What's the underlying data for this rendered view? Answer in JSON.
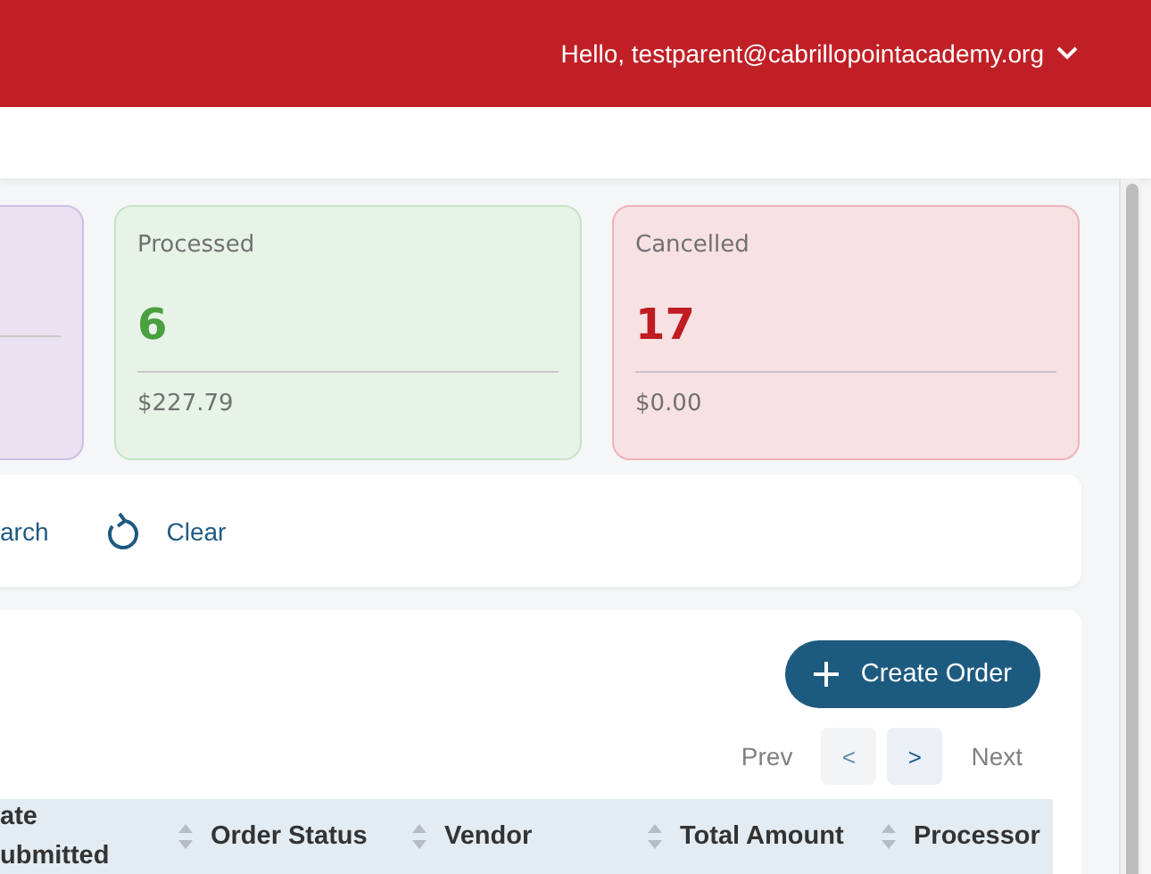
{
  "header": {
    "greeting": "Hello, testparent@cabrillopointacademy.org"
  },
  "summary_cards": [
    {
      "color": "#e9e3f1"
    },
    {
      "label": "Processed",
      "count": "6",
      "amount": "$227.79",
      "color": "#e8f3e8"
    },
    {
      "label": "Cancelled",
      "count": "17",
      "amount": "$0.00",
      "color": "#f7e1e3"
    }
  ],
  "search_panel": {
    "search_label": "arch",
    "clear_label": "Clear"
  },
  "orders": {
    "create_button": "Create Order",
    "pagination": {
      "prev_label": "Prev",
      "prev_button": "<",
      "next_button": ">",
      "next_label": "Next",
      "prev_disabled": true
    },
    "table": {
      "columns": [
        "ate\nubmitted",
        "Order Status",
        "Vendor",
        "Total Amount",
        "Processor"
      ]
    }
  }
}
